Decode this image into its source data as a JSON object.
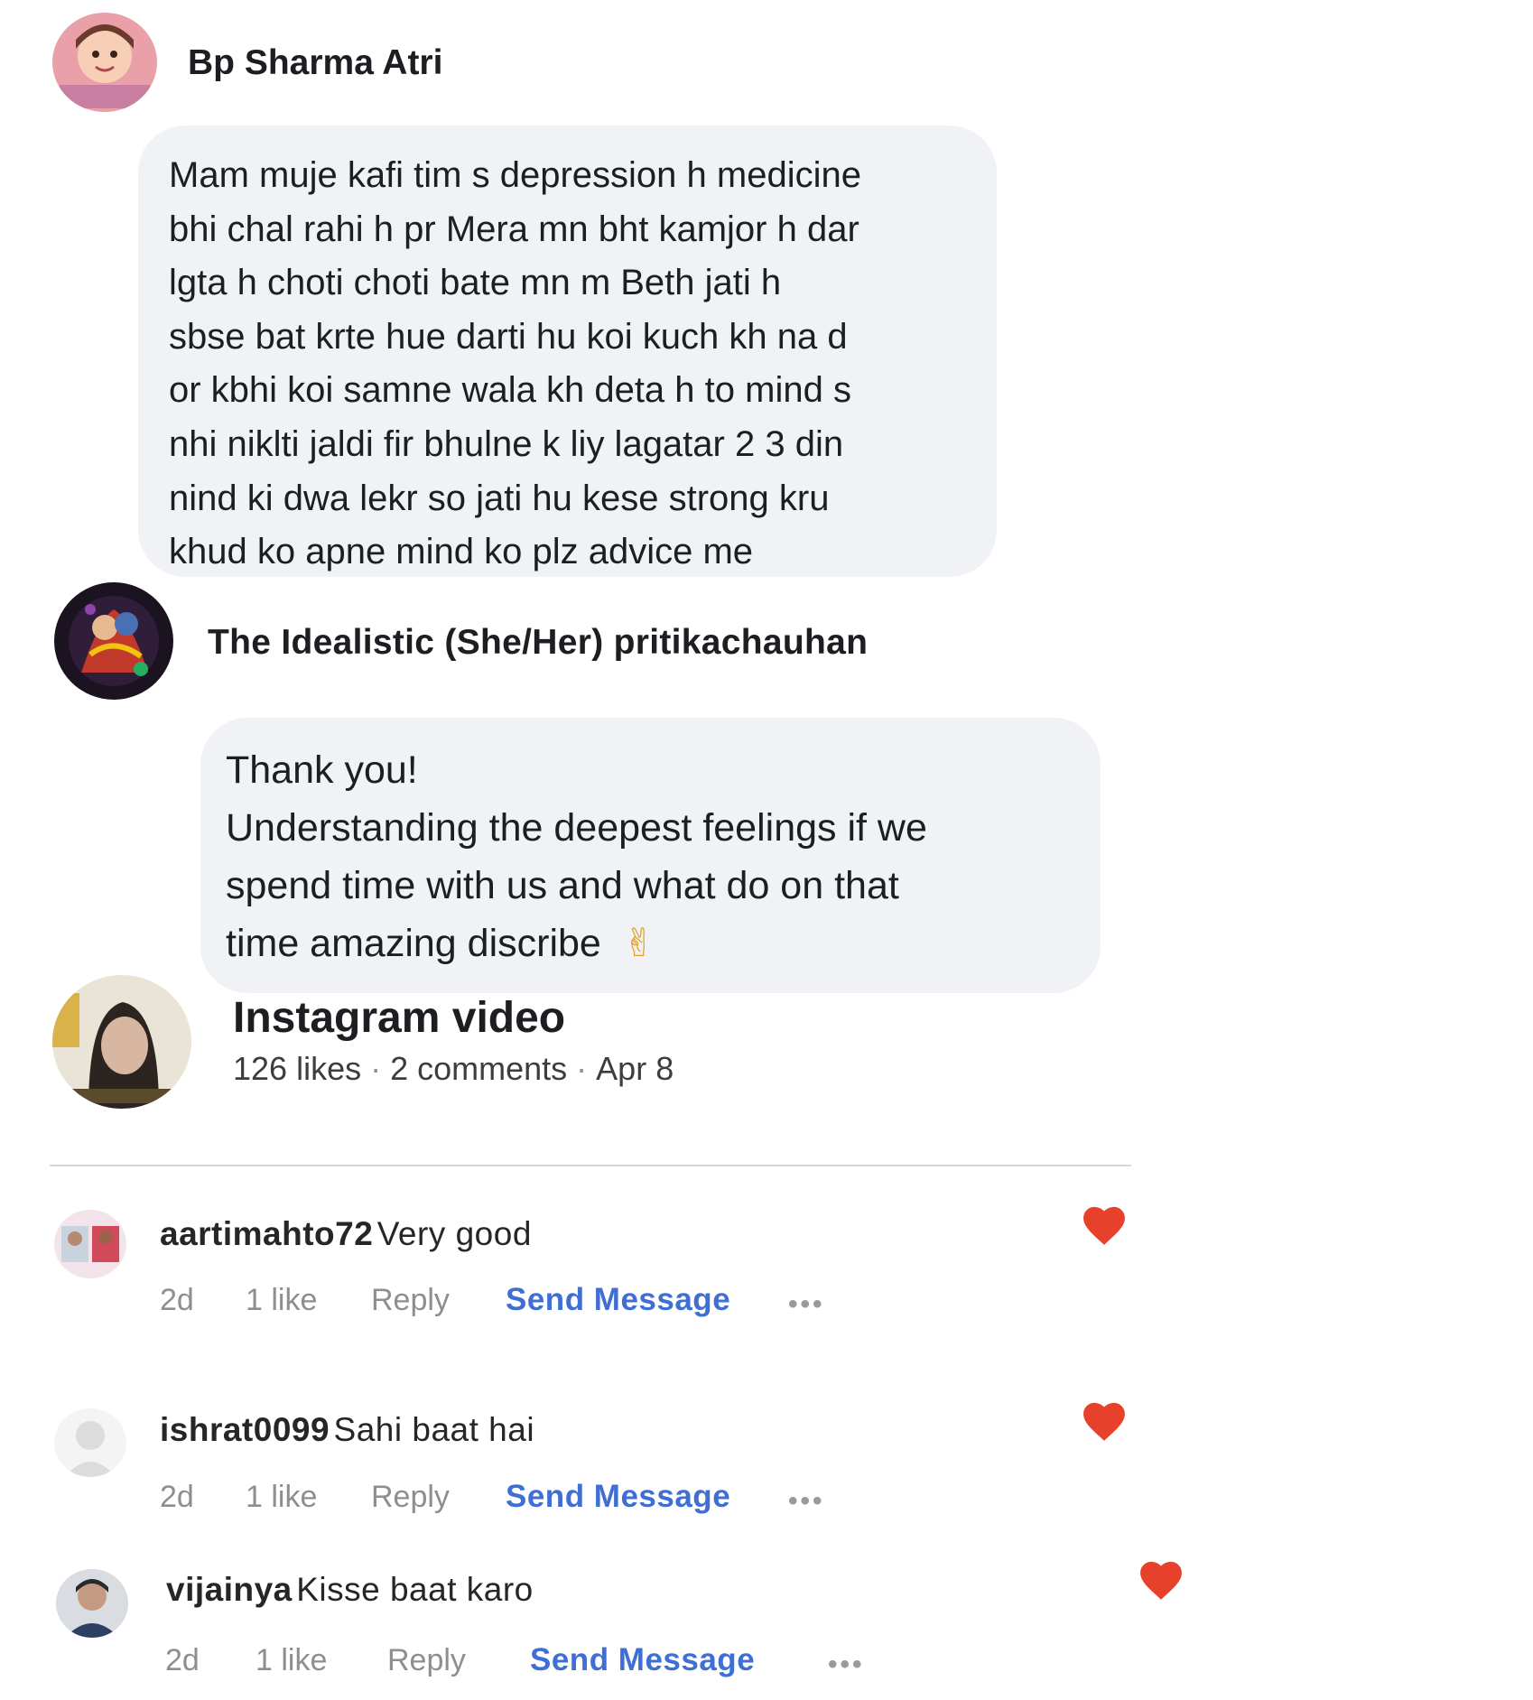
{
  "thread": {
    "first_comment": {
      "author": "Bp Sharma Atri",
      "lines": [
        "Mam muje kafi tim s depression h medicine",
        "bhi chal rahi h pr Mera mn bht kamjor h dar",
        "lgta h choti choti bate mn m  Beth jati h",
        "sbse bat krte hue darti hu koi kuch kh na d",
        "or kbhi koi samne wala kh deta h to mind s",
        "nhi niklti jaldi fir bhulne k liy lagatar 2 3 din",
        "nind ki dwa lekr so jati hu kese strong kru",
        "khud ko apne mind ko plz advice me"
      ]
    },
    "reply": {
      "author": "The Idealistic (She/Her) pritikachauhan",
      "lines": [
        "Thank you!",
        "Understanding the deepest feelings if we",
        "spend time with us and what do on that",
        "time amazing discribe"
      ],
      "emoji": "✌"
    }
  },
  "post": {
    "title": "Instagram video",
    "likes": "126 likes",
    "comments": "2 comments",
    "date": "Apr 8",
    "separator": "·"
  },
  "comments": [
    {
      "user": "aartimahto72",
      "text": "Very good",
      "age": "2d",
      "likes": "1 like",
      "reply": "Reply",
      "send": "Send Message",
      "more": "•••",
      "liked": true
    },
    {
      "user": "ishrat0099",
      "text": "Sahi baat hai",
      "age": "2d",
      "likes": "1 like",
      "reply": "Reply",
      "send": "Send Message",
      "more": "•••",
      "liked": true
    },
    {
      "user": "vijainya",
      "text": "Kisse baat karo",
      "age": "2d",
      "likes": "1 like",
      "reply": "Reply",
      "send": "Send Message",
      "more": "•••",
      "liked": true
    }
  ],
  "colors": {
    "bubble": "#f0f2f5",
    "send_message": "#3f6fd4",
    "heart": "#e8412b",
    "meta": "#8e8e8e"
  },
  "icons": [
    "heart-icon",
    "more-icon",
    "default-avatar-icon"
  ]
}
